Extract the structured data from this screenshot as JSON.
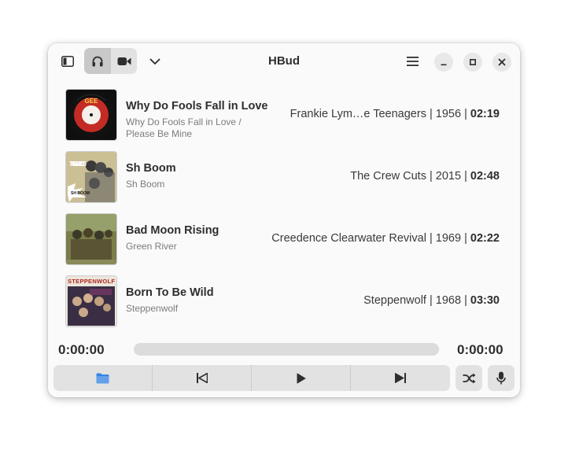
{
  "window": {
    "title": "HBud"
  },
  "header": {
    "sidebar_toggle_icon": "sidebar-icon",
    "audio_mode_icon": "headphones-icon",
    "video_mode_icon": "video-camera-icon",
    "dropdown_icon": "chevron-down-icon",
    "menu_icon": "hamburger-menu-icon"
  },
  "playlist": [
    {
      "title": "Why Do Fools Fall in Love",
      "album": "Why Do Fools Fall in Love / Please Be Mine",
      "artist": "Frankie Lym…e Teenagers",
      "year": "1956",
      "duration": "02:19"
    },
    {
      "title": "Sh Boom",
      "album": "Sh Boom",
      "artist": "The Crew Cuts",
      "year": "2015",
      "duration": "02:48"
    },
    {
      "title": "Bad Moon Rising",
      "album": "Green River",
      "artist": "Creedence Clearwater Revival",
      "year": "1969",
      "duration": "02:22"
    },
    {
      "title": "Born To Be Wild",
      "album": "Steppenwolf",
      "artist": "Steppenwolf",
      "year": "1968",
      "duration": "03:30"
    }
  ],
  "covers": [
    {
      "text": "GEE"
    },
    {
      "text": "THE CREW CUTS",
      "sticker": "SH BOOM"
    },
    {
      "text": ""
    },
    {
      "text": "STEPPENWOLF"
    }
  ],
  "player": {
    "elapsed": "0:00:00",
    "remaining": "0:00:00",
    "progress": 0.0,
    "separator": "|"
  },
  "colors": {
    "accent": "#3584e4",
    "window_bg": "#fafafa",
    "button_bg": "#e2e2e2"
  }
}
